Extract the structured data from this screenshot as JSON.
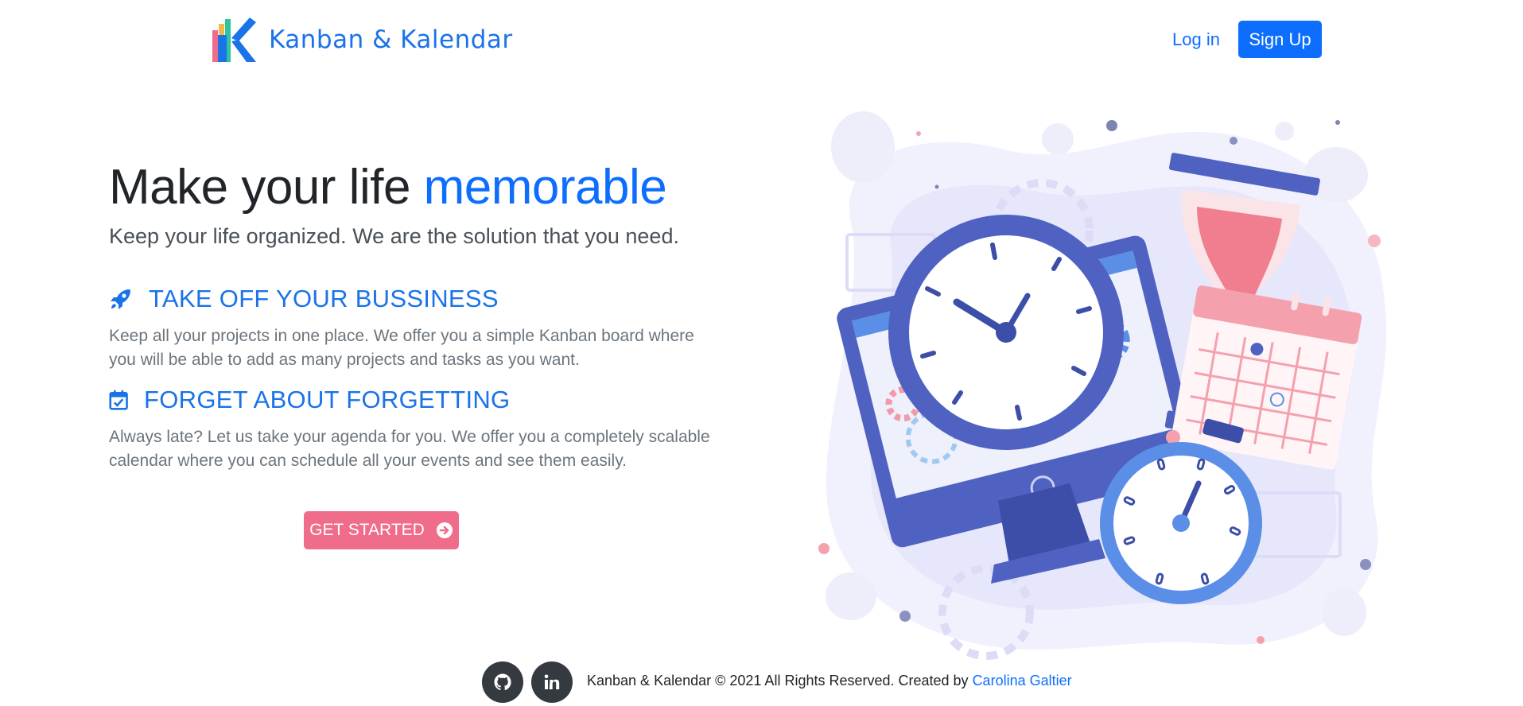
{
  "brand": {
    "name": "Kanban & Kalendar",
    "logo_icon": "k-logo-icon"
  },
  "nav": {
    "login_label": "Log in",
    "signup_label": "Sign Up"
  },
  "hero": {
    "title_part1": "Make your life ",
    "title_accent": "memorable",
    "subtitle": "Keep your life organized. We are the solution that you need."
  },
  "features": [
    {
      "icon": "rocket-icon",
      "title": "TAKE OFF YOUR BUSSINESS",
      "text": "Keep all your projects in one place. We offer you a simple Kanban board where you will be able to add as many projects and tasks as you want."
    },
    {
      "icon": "calendar-check-icon",
      "title": "FORGET ABOUT FORGETTING",
      "text": "Always late? Let us take your agenda for you. We offer you a completely scalable calendar where you can schedule all your events and see them easily."
    }
  ],
  "cta": {
    "label": "GET STARTED",
    "icon": "arrow-circle-right-icon"
  },
  "footer": {
    "social": [
      {
        "name": "github-icon"
      },
      {
        "name": "linkedin-icon"
      }
    ],
    "copyright_text": "Kanban & Kalendar © 2021 All Rights Reserved. Created by ",
    "author_link": "Carolina Galtier"
  },
  "colors": {
    "primary": "#0d6efd",
    "brand_blue": "#1a73e8",
    "cta_pink": "#f06c8b",
    "text_dark": "#212529",
    "text_muted": "#6c757d",
    "footer_icon_bg": "#343a40"
  }
}
